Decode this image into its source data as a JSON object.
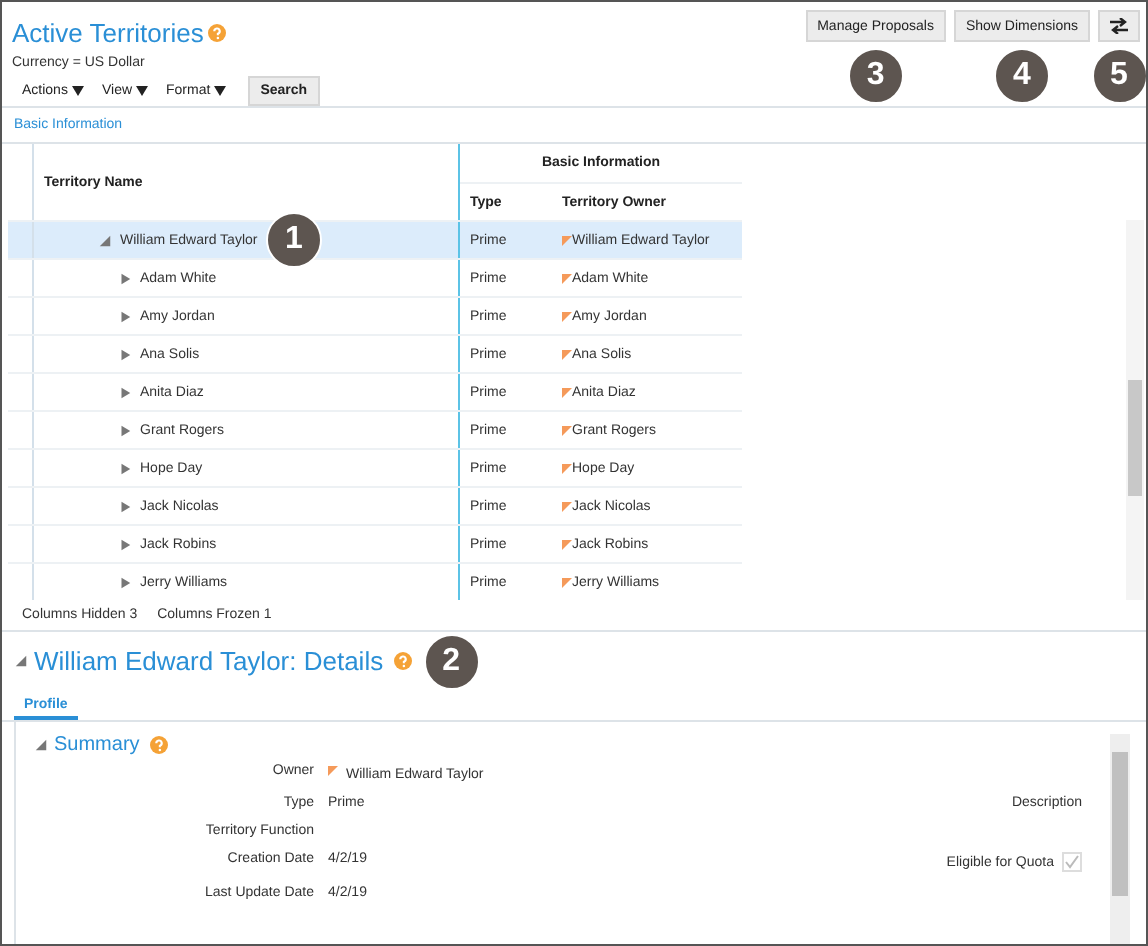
{
  "header": {
    "title": "Active Territories",
    "currency": "Currency = US Dollar",
    "menus": [
      {
        "label": "Actions"
      },
      {
        "label": "View"
      },
      {
        "label": "Format"
      }
    ],
    "search_button": "Search",
    "buttons": [
      {
        "kind": "text",
        "label": "Manage Proposals",
        "callout": "3"
      },
      {
        "kind": "text",
        "label": "Show Dimensions",
        "callout": "4"
      },
      {
        "kind": "icon",
        "callout": "5"
      }
    ]
  },
  "view_link": "Basic Information",
  "table": {
    "group_header": "Basic Information",
    "columns": [
      "Territory Name",
      "Type",
      "Territory Owner"
    ],
    "rows": [
      {
        "name": "William Edward Taylor",
        "type": "Prime",
        "owner": "William Edward Taylor",
        "expanded": true,
        "selected": true,
        "callout": "1",
        "children": [
          {
            "name": "Adam White",
            "type": "Prime",
            "owner": "Adam White",
            "expanded": false,
            "selected": false
          },
          {
            "name": "Amy Jordan",
            "type": "Prime",
            "owner": "Amy Jordan",
            "expanded": false,
            "selected": false
          },
          {
            "name": "Ana Solis",
            "type": "Prime",
            "owner": "Ana Solis",
            "expanded": false,
            "selected": false
          },
          {
            "name": "Anita Diaz",
            "type": "Prime",
            "owner": "Anita Diaz",
            "expanded": false,
            "selected": false
          },
          {
            "name": "Grant Rogers",
            "type": "Prime",
            "owner": "Grant Rogers",
            "expanded": false,
            "selected": false
          },
          {
            "name": "Hope Day",
            "type": "Prime",
            "owner": "Hope Day",
            "expanded": false,
            "selected": false
          },
          {
            "name": "Jack Nicolas",
            "type": "Prime",
            "owner": "Jack Nicolas",
            "expanded": false,
            "selected": false
          },
          {
            "name": "Jack Robins",
            "type": "Prime",
            "owner": "Jack Robins",
            "expanded": false,
            "selected": false
          },
          {
            "name": "Jerry Williams",
            "type": "Prime",
            "owner": "Jerry Williams",
            "expanded": false,
            "selected": false
          }
        ]
      }
    ]
  },
  "footer": [
    {
      "label": "Columns Hidden",
      "value": "3"
    },
    {
      "label": "Columns Frozen",
      "value": "1"
    }
  ],
  "details": {
    "title": "William Edward Taylor: Details",
    "expanded": true,
    "callout": "2",
    "tabs": [
      {
        "label": "Profile",
        "selected": true
      }
    ],
    "section": {
      "title": "Summary",
      "expanded": true,
      "fields": [
        {
          "kind": "person",
          "label": "Owner",
          "value": "William Edward Taylor"
        },
        {
          "kind": "text",
          "label": "Type",
          "value": "Prime"
        },
        {
          "kind": "text",
          "label": "Territory Function"
        },
        {
          "kind": "text",
          "label": "Creation Date",
          "value": "4/2/19"
        },
        {
          "kind": "text",
          "label": "Last Update Date",
          "value": "4/2/19"
        }
      ],
      "description_label": "Description",
      "quota": {
        "label": "Eligible for Quota",
        "checked": true,
        "disabled": true
      }
    }
  }
}
